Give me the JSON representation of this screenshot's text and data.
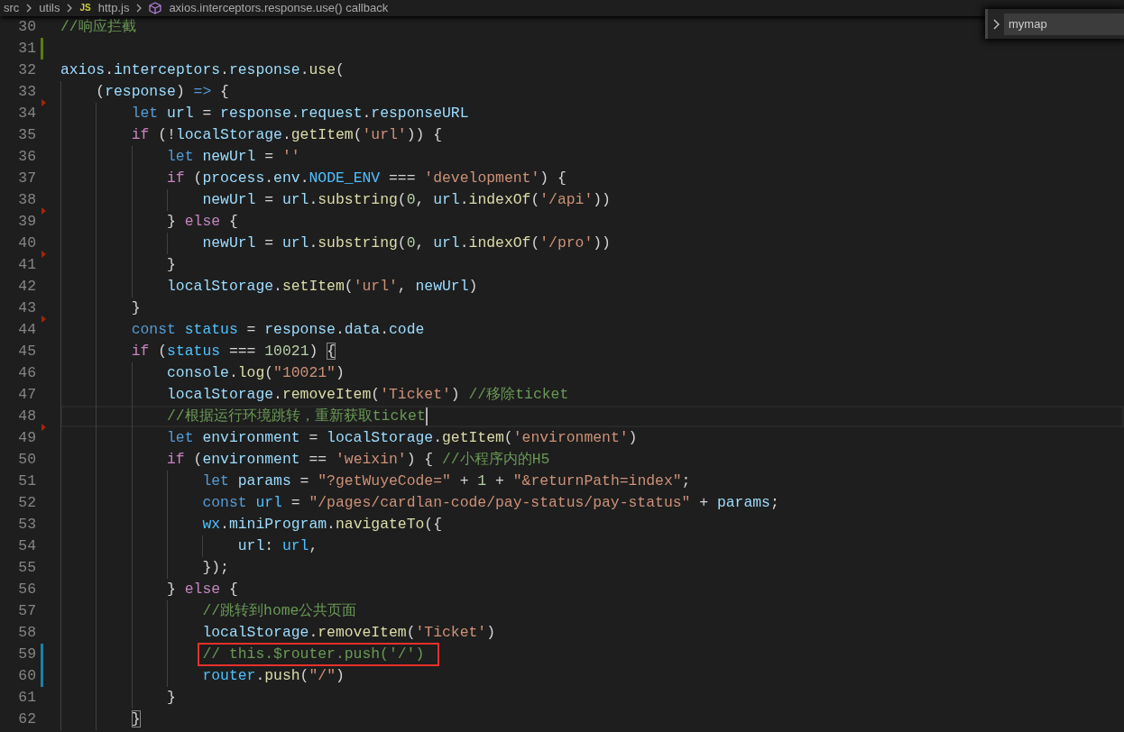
{
  "breadcrumbs": [
    {
      "kind": "folder",
      "label": "src"
    },
    {
      "kind": "folder",
      "label": "utils"
    },
    {
      "kind": "file",
      "icon": "JS",
      "label": "http.js"
    },
    {
      "kind": "symbol",
      "label": "axios.interceptors.response.use() callback"
    }
  ],
  "find": {
    "value": "mymap",
    "replace_expanded": false
  },
  "lines": [
    {
      "number": "30",
      "kind": "unchanged",
      "current": false,
      "annotated": false,
      "tokens": [
        {
          "kind": "comment",
          "text": "//响应拦截"
        }
      ]
    },
    {
      "number": "31",
      "kind": "added",
      "current": false,
      "annotated": false
    },
    {
      "number": "32",
      "kind": "unchanged",
      "current": false,
      "annotated": false,
      "tokens": [
        {
          "kind": "variable",
          "text": "axios"
        },
        {
          "kind": "punct",
          "text": "."
        },
        {
          "kind": "variable",
          "text": "interceptors"
        },
        {
          "kind": "punct",
          "text": "."
        },
        {
          "kind": "variable",
          "text": "response"
        },
        {
          "kind": "punct",
          "text": "."
        },
        {
          "kind": "function",
          "text": "use"
        },
        {
          "kind": "punct",
          "text": "("
        }
      ],
      "children": [
        {
          "number": "33",
          "kind": "unchanged",
          "current": false,
          "annotated": false,
          "tokens": [
            {
              "kind": "punct",
              "text": "("
            },
            {
              "kind": "variable",
              "text": "response"
            },
            {
              "kind": "punct",
              "text": ") "
            },
            {
              "kind": "keyword",
              "text": "=>"
            },
            {
              "kind": "punct",
              "text": " {"
            }
          ],
          "children": [
            {
              "number": "34",
              "kind": "deleted",
              "current": false,
              "annotated": false,
              "tokens": [
                {
                  "kind": "keyword",
                  "text": "let "
                },
                {
                  "kind": "variable",
                  "text": "url"
                },
                {
                  "kind": "punct",
                  "text": " = "
                },
                {
                  "kind": "variable",
                  "text": "response"
                },
                {
                  "kind": "punct",
                  "text": "."
                },
                {
                  "kind": "variable",
                  "text": "request"
                },
                {
                  "kind": "punct",
                  "text": "."
                },
                {
                  "kind": "variable",
                  "text": "responseURL"
                }
              ]
            },
            {
              "number": "35",
              "kind": "unchanged",
              "current": false,
              "annotated": false,
              "tokens": [
                {
                  "kind": "control",
                  "text": "if"
                },
                {
                  "kind": "punct",
                  "text": " (!"
                },
                {
                  "kind": "variable",
                  "text": "localStorage"
                },
                {
                  "kind": "punct",
                  "text": "."
                },
                {
                  "kind": "function",
                  "text": "getItem"
                },
                {
                  "kind": "punct",
                  "text": "("
                },
                {
                  "kind": "string",
                  "text": "'url'"
                },
                {
                  "kind": "punct",
                  "text": ")) {"
                }
              ],
              "children": [
                {
                  "number": "36",
                  "kind": "unchanged",
                  "current": false,
                  "annotated": false,
                  "tokens": [
                    {
                      "kind": "keyword",
                      "text": "let "
                    },
                    {
                      "kind": "variable",
                      "text": "newUrl"
                    },
                    {
                      "kind": "punct",
                      "text": " = "
                    },
                    {
                      "kind": "string",
                      "text": "''"
                    }
                  ]
                },
                {
                  "number": "37",
                  "kind": "unchanged",
                  "current": false,
                  "annotated": false,
                  "tokens": [
                    {
                      "kind": "control",
                      "text": "if"
                    },
                    {
                      "kind": "punct",
                      "text": " ("
                    },
                    {
                      "kind": "variable",
                      "text": "process"
                    },
                    {
                      "kind": "punct",
                      "text": "."
                    },
                    {
                      "kind": "variable",
                      "text": "env"
                    },
                    {
                      "kind": "punct",
                      "text": "."
                    },
                    {
                      "kind": "constant",
                      "text": "NODE_ENV"
                    },
                    {
                      "kind": "punct",
                      "text": " === "
                    },
                    {
                      "kind": "string",
                      "text": "'development'"
                    },
                    {
                      "kind": "punct",
                      "text": ") {"
                    }
                  ],
                  "children": [
                    {
                      "number": "38",
                      "kind": "unchanged",
                      "current": false,
                      "annotated": false,
                      "tokens": [
                        {
                          "kind": "variable",
                          "text": "newUrl"
                        },
                        {
                          "kind": "punct",
                          "text": " = "
                        },
                        {
                          "kind": "variable",
                          "text": "url"
                        },
                        {
                          "kind": "punct",
                          "text": "."
                        },
                        {
                          "kind": "function",
                          "text": "substring"
                        },
                        {
                          "kind": "punct",
                          "text": "("
                        },
                        {
                          "kind": "number",
                          "text": "0"
                        },
                        {
                          "kind": "punct",
                          "text": ", "
                        },
                        {
                          "kind": "variable",
                          "text": "url"
                        },
                        {
                          "kind": "punct",
                          "text": "."
                        },
                        {
                          "kind": "function",
                          "text": "indexOf"
                        },
                        {
                          "kind": "punct",
                          "text": "("
                        },
                        {
                          "kind": "string",
                          "text": "'/api'"
                        },
                        {
                          "kind": "punct",
                          "text": "))"
                        }
                      ]
                    }
                  ]
                },
                {
                  "number": "39",
                  "kind": "deleted",
                  "current": false,
                  "annotated": false,
                  "tokens": [
                    {
                      "kind": "punct",
                      "text": "} "
                    },
                    {
                      "kind": "control",
                      "text": "else"
                    },
                    {
                      "kind": "punct",
                      "text": " {"
                    }
                  ],
                  "children": [
                    {
                      "number": "40",
                      "kind": "unchanged",
                      "current": false,
                      "annotated": false,
                      "tokens": [
                        {
                          "kind": "variable",
                          "text": "newUrl"
                        },
                        {
                          "kind": "punct",
                          "text": " = "
                        },
                        {
                          "kind": "variable",
                          "text": "url"
                        },
                        {
                          "kind": "punct",
                          "text": "."
                        },
                        {
                          "kind": "function",
                          "text": "substring"
                        },
                        {
                          "kind": "punct",
                          "text": "("
                        },
                        {
                          "kind": "number",
                          "text": "0"
                        },
                        {
                          "kind": "punct",
                          "text": ", "
                        },
                        {
                          "kind": "variable",
                          "text": "url"
                        },
                        {
                          "kind": "punct",
                          "text": "."
                        },
                        {
                          "kind": "function",
                          "text": "indexOf"
                        },
                        {
                          "kind": "punct",
                          "text": "("
                        },
                        {
                          "kind": "string",
                          "text": "'/pro'"
                        },
                        {
                          "kind": "punct",
                          "text": "))"
                        }
                      ]
                    }
                  ]
                },
                {
                  "number": "41",
                  "kind": "deleted",
                  "current": false,
                  "annotated": false,
                  "tokens": [
                    {
                      "kind": "punct",
                      "text": "}"
                    }
                  ]
                },
                {
                  "number": "42",
                  "kind": "unchanged",
                  "current": false,
                  "annotated": false,
                  "tokens": [
                    {
                      "kind": "variable",
                      "text": "localStorage"
                    },
                    {
                      "kind": "punct",
                      "text": "."
                    },
                    {
                      "kind": "function",
                      "text": "setItem"
                    },
                    {
                      "kind": "punct",
                      "text": "("
                    },
                    {
                      "kind": "string",
                      "text": "'url'"
                    },
                    {
                      "kind": "punct",
                      "text": ", "
                    },
                    {
                      "kind": "variable",
                      "text": "newUrl"
                    },
                    {
                      "kind": "punct",
                      "text": ")"
                    }
                  ]
                }
              ]
            },
            {
              "number": "43",
              "kind": "unchanged",
              "current": false,
              "annotated": false,
              "tokens": [
                {
                  "kind": "punct",
                  "text": "}"
                }
              ]
            },
            {
              "number": "44",
              "kind": "deleted",
              "current": false,
              "annotated": false,
              "tokens": [
                {
                  "kind": "keyword",
                  "text": "const "
                },
                {
                  "kind": "constant",
                  "text": "status"
                },
                {
                  "kind": "punct",
                  "text": " = "
                },
                {
                  "kind": "variable",
                  "text": "response"
                },
                {
                  "kind": "punct",
                  "text": "."
                },
                {
                  "kind": "variable",
                  "text": "data"
                },
                {
                  "kind": "punct",
                  "text": "."
                },
                {
                  "kind": "variable",
                  "text": "code"
                }
              ]
            },
            {
              "number": "45",
              "kind": "unchanged",
              "current": false,
              "annotated": false,
              "tokens": [
                {
                  "kind": "control",
                  "text": "if"
                },
                {
                  "kind": "punct",
                  "text": " ("
                },
                {
                  "kind": "constant",
                  "text": "status"
                },
                {
                  "kind": "punct",
                  "text": " === "
                },
                {
                  "kind": "number",
                  "text": "10021"
                },
                {
                  "kind": "punct",
                  "text": ") "
                },
                {
                  "kind": "bracket",
                  "text": "{"
                }
              ],
              "children": [
                {
                  "number": "46",
                  "kind": "unchanged",
                  "current": false,
                  "annotated": false,
                  "tokens": [
                    {
                      "kind": "variable",
                      "text": "console"
                    },
                    {
                      "kind": "punct",
                      "text": "."
                    },
                    {
                      "kind": "function",
                      "text": "log"
                    },
                    {
                      "kind": "punct",
                      "text": "("
                    },
                    {
                      "kind": "string",
                      "text": "\"10021\""
                    },
                    {
                      "kind": "punct",
                      "text": ")"
                    }
                  ]
                },
                {
                  "number": "47",
                  "kind": "unchanged",
                  "current": false,
                  "annotated": false,
                  "tokens": [
                    {
                      "kind": "variable",
                      "text": "localStorage"
                    },
                    {
                      "kind": "punct",
                      "text": "."
                    },
                    {
                      "kind": "function",
                      "text": "removeItem"
                    },
                    {
                      "kind": "punct",
                      "text": "("
                    },
                    {
                      "kind": "string",
                      "text": "'Ticket'"
                    },
                    {
                      "kind": "punct",
                      "text": ") "
                    },
                    {
                      "kind": "comment",
                      "text": "//移除ticket"
                    }
                  ]
                },
                {
                  "number": "48",
                  "kind": "unchanged",
                  "current": true,
                  "annotated": false,
                  "tokens": [
                    {
                      "kind": "comment",
                      "text": "//根据运行环境跳转，重新获取ticket"
                    }
                  ]
                },
                {
                  "number": "49",
                  "kind": "deleted",
                  "current": false,
                  "annotated": false,
                  "tokens": [
                    {
                      "kind": "keyword",
                      "text": "let "
                    },
                    {
                      "kind": "variable",
                      "text": "environment"
                    },
                    {
                      "kind": "punct",
                      "text": " = "
                    },
                    {
                      "kind": "variable",
                      "text": "localStorage"
                    },
                    {
                      "kind": "punct",
                      "text": "."
                    },
                    {
                      "kind": "function",
                      "text": "getItem"
                    },
                    {
                      "kind": "punct",
                      "text": "("
                    },
                    {
                      "kind": "string",
                      "text": "'environment'"
                    },
                    {
                      "kind": "punct",
                      "text": ")"
                    }
                  ]
                },
                {
                  "number": "50",
                  "kind": "unchanged",
                  "current": false,
                  "annotated": false,
                  "tokens": [
                    {
                      "kind": "control",
                      "text": "if"
                    },
                    {
                      "kind": "punct",
                      "text": " ("
                    },
                    {
                      "kind": "variable",
                      "text": "environment"
                    },
                    {
                      "kind": "punct",
                      "text": " == "
                    },
                    {
                      "kind": "string",
                      "text": "'weixin'"
                    },
                    {
                      "kind": "punct",
                      "text": ") { "
                    },
                    {
                      "kind": "comment",
                      "text": "//小程序内的H5"
                    }
                  ],
                  "children": [
                    {
                      "number": "51",
                      "kind": "unchanged",
                      "current": false,
                      "annotated": false,
                      "tokens": [
                        {
                          "kind": "keyword",
                          "text": "let "
                        },
                        {
                          "kind": "variable",
                          "text": "params"
                        },
                        {
                          "kind": "punct",
                          "text": " = "
                        },
                        {
                          "kind": "string",
                          "text": "\"?getWuyeCode=\""
                        },
                        {
                          "kind": "punct",
                          "text": " + "
                        },
                        {
                          "kind": "number",
                          "text": "1"
                        },
                        {
                          "kind": "punct",
                          "text": " + "
                        },
                        {
                          "kind": "string",
                          "text": "\"&returnPath=index\""
                        },
                        {
                          "kind": "punct",
                          "text": ";"
                        }
                      ]
                    },
                    {
                      "number": "52",
                      "kind": "unchanged",
                      "current": false,
                      "annotated": false,
                      "tokens": [
                        {
                          "kind": "keyword",
                          "text": "const "
                        },
                        {
                          "kind": "constant",
                          "text": "url"
                        },
                        {
                          "kind": "punct",
                          "text": " = "
                        },
                        {
                          "kind": "string",
                          "text": "\"/pages/cardlan-code/pay-status/pay-status\""
                        },
                        {
                          "kind": "punct",
                          "text": " + "
                        },
                        {
                          "kind": "variable",
                          "text": "params"
                        },
                        {
                          "kind": "punct",
                          "text": ";"
                        }
                      ]
                    },
                    {
                      "number": "53",
                      "kind": "unchanged",
                      "current": false,
                      "annotated": false,
                      "tokens": [
                        {
                          "kind": "constant",
                          "text": "wx"
                        },
                        {
                          "kind": "punct",
                          "text": "."
                        },
                        {
                          "kind": "variable",
                          "text": "miniProgram"
                        },
                        {
                          "kind": "punct",
                          "text": "."
                        },
                        {
                          "kind": "function",
                          "text": "navigateTo"
                        },
                        {
                          "kind": "punct",
                          "text": "({"
                        }
                      ],
                      "children": [
                        {
                          "number": "54",
                          "kind": "unchanged",
                          "current": false,
                          "annotated": false,
                          "tokens": [
                            {
                              "kind": "variable",
                              "text": "url"
                            },
                            {
                              "kind": "punct",
                              "text": ": "
                            },
                            {
                              "kind": "constant",
                              "text": "url"
                            },
                            {
                              "kind": "punct",
                              "text": ","
                            }
                          ]
                        }
                      ]
                    },
                    {
                      "number": "55",
                      "kind": "unchanged",
                      "current": false,
                      "annotated": false,
                      "tokens": [
                        {
                          "kind": "punct",
                          "text": "});"
                        }
                      ]
                    }
                  ]
                },
                {
                  "number": "56",
                  "kind": "unchanged",
                  "current": false,
                  "annotated": false,
                  "tokens": [
                    {
                      "kind": "punct",
                      "text": "} "
                    },
                    {
                      "kind": "control",
                      "text": "else"
                    },
                    {
                      "kind": "punct",
                      "text": " {"
                    }
                  ],
                  "children": [
                    {
                      "number": "57",
                      "kind": "unchanged",
                      "current": false,
                      "annotated": false,
                      "tokens": [
                        {
                          "kind": "comment",
                          "text": "//跳转到home公共页面"
                        }
                      ]
                    },
                    {
                      "number": "58",
                      "kind": "unchanged",
                      "current": false,
                      "annotated": false,
                      "tokens": [
                        {
                          "kind": "variable",
                          "text": "localStorage"
                        },
                        {
                          "kind": "punct",
                          "text": "."
                        },
                        {
                          "kind": "function",
                          "text": "removeItem"
                        },
                        {
                          "kind": "punct",
                          "text": "("
                        },
                        {
                          "kind": "string",
                          "text": "'Ticket'"
                        },
                        {
                          "kind": "punct",
                          "text": ")"
                        }
                      ]
                    },
                    {
                      "number": "59",
                      "kind": "modified",
                      "current": false,
                      "annotated": true,
                      "tokens": [
                        {
                          "kind": "comment",
                          "text": "// this.$router.push('/')"
                        }
                      ]
                    },
                    {
                      "number": "60",
                      "kind": "modified",
                      "current": false,
                      "annotated": false,
                      "tokens": [
                        {
                          "kind": "constant",
                          "text": "router"
                        },
                        {
                          "kind": "punct",
                          "text": "."
                        },
                        {
                          "kind": "function",
                          "text": "push"
                        },
                        {
                          "kind": "punct",
                          "text": "("
                        },
                        {
                          "kind": "string",
                          "text": "\"/\""
                        },
                        {
                          "kind": "punct",
                          "text": ")"
                        }
                      ]
                    }
                  ]
                },
                {
                  "number": "61",
                  "kind": "unchanged",
                  "current": false,
                  "annotated": false,
                  "tokens": [
                    {
                      "kind": "punct",
                      "text": "}"
                    }
                  ]
                }
              ]
            },
            {
              "number": "62",
              "kind": "unchanged",
              "current": false,
              "annotated": false,
              "tokens": [
                {
                  "kind": "bracket",
                  "text": "}"
                }
              ]
            }
          ]
        }
      ]
    }
  ]
}
